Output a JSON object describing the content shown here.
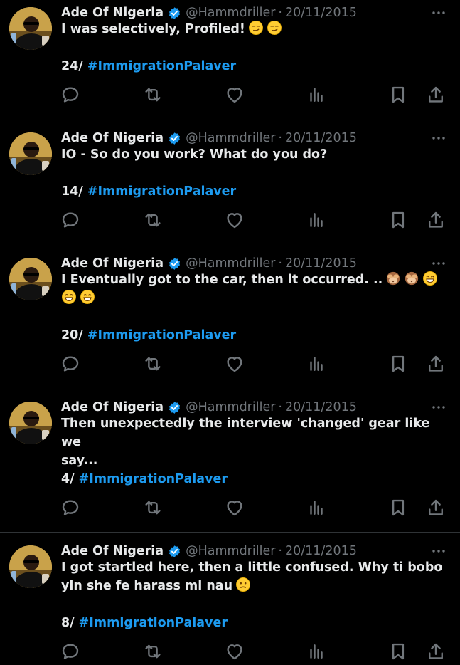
{
  "colors": {
    "background": "#000000",
    "text": "#e7e9ea",
    "muted": "#71767b",
    "link": "#1d9bf0",
    "separator": "#2f3336",
    "verified": "#1d9bf0"
  },
  "icons": {
    "verified": "verified-badge-icon",
    "more": "more-horizontal-icon",
    "reply": "reply-icon",
    "retweet": "retweet-icon",
    "like": "heart-icon",
    "views": "views-icon",
    "bookmark": "bookmark-icon",
    "share": "share-icon"
  },
  "tweets": [
    {
      "author": "Ade Of Nigeria",
      "handle": "@Hammdriller",
      "separator": "·",
      "date": "20/11/2015",
      "lines": [
        "I was selectively, Profiled!"
      ],
      "emojis": [
        [
          "smirk",
          "smirk"
        ]
      ],
      "thread_num": "24/",
      "hashtag": "#ImmigrationPalaver"
    },
    {
      "author": "Ade Of Nigeria",
      "handle": "@Hammdriller",
      "separator": "·",
      "date": "20/11/2015",
      "lines": [
        "IO - So do you work? What do you do?"
      ],
      "emojis": [
        []
      ],
      "thread_num": "14/",
      "hashtag": "#ImmigrationPalaver"
    },
    {
      "author": "Ade Of Nigeria",
      "handle": "@Hammdriller",
      "separator": "·",
      "date": "20/11/2015",
      "lines": [
        "I Eventually got to the car, then it occurred. ..",
        ""
      ],
      "emojis": [
        [
          "see-no-evil",
          "see-no-evil",
          "grin"
        ],
        [
          "grin",
          "grin"
        ]
      ],
      "thread_num": "20/",
      "hashtag": "#ImmigrationPalaver"
    },
    {
      "author": "Ade Of Nigeria",
      "handle": "@Hammdriller",
      "separator": "·",
      "date": "20/11/2015",
      "lines": [
        "Then unexpectedly the interview 'changed' gear like we",
        "say..."
      ],
      "emojis": [
        [],
        []
      ],
      "thread_num": "4/",
      "hashtag": "#ImmigrationPalaver"
    },
    {
      "author": "Ade Of Nigeria",
      "handle": "@Hammdriller",
      "separator": "·",
      "date": "20/11/2015",
      "lines": [
        "I got startled here, then a little confused. Why ti bobo",
        "yin she fe harass mi nau"
      ],
      "emojis": [
        [],
        [
          "confused"
        ]
      ],
      "thread_num": "8/",
      "hashtag": "#ImmigrationPalaver"
    }
  ]
}
